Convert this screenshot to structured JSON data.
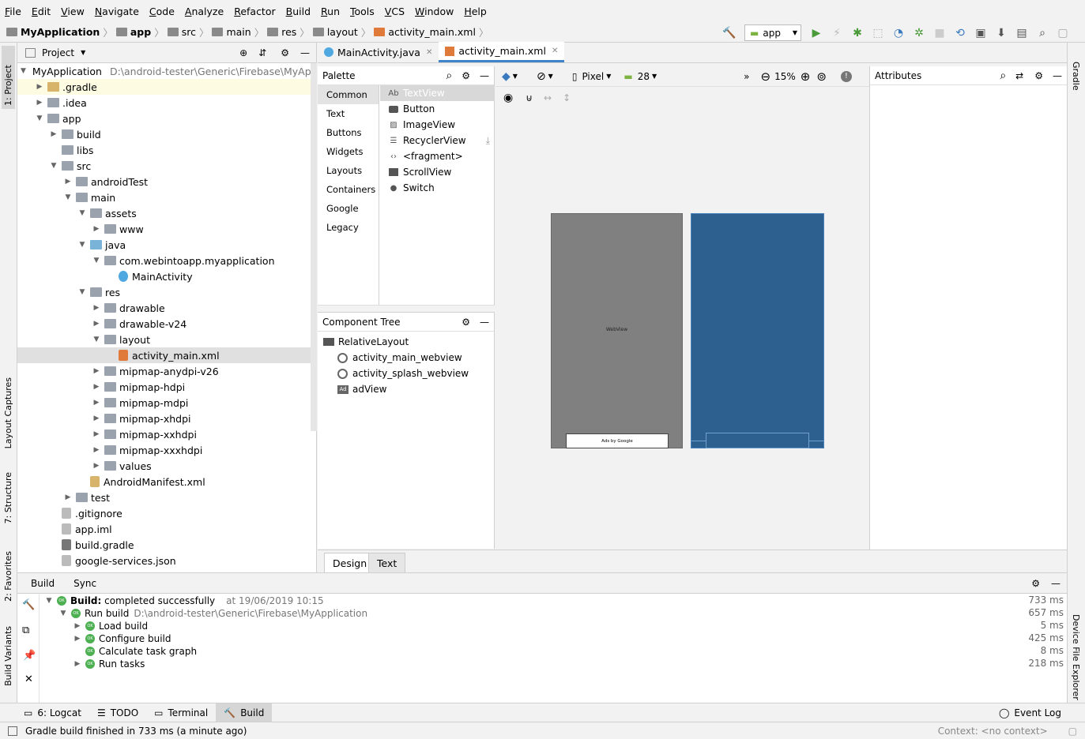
{
  "menu": [
    "File",
    "Edit",
    "View",
    "Navigate",
    "Code",
    "Analyze",
    "Refactor",
    "Build",
    "Run",
    "Tools",
    "VCS",
    "Window",
    "Help"
  ],
  "breadcrumb": [
    "MyApplication",
    "app",
    "src",
    "main",
    "res",
    "layout",
    "activity_main.xml"
  ],
  "run_config": "app",
  "left_tabs": {
    "project": "1: Project",
    "captures": "Layout Captures",
    "structure": "7: Structure",
    "favorites": "2: Favorites",
    "variants": "Build Variants"
  },
  "right_tabs": {
    "gradle": "Gradle",
    "device": "Device File Explorer"
  },
  "project_panel": {
    "title": "Project",
    "root": {
      "name": "MyApplication",
      "path": "D:\\android-tester\\Generic\\Firebase\\MyApplicati"
    },
    "items": [
      ".gradle",
      ".idea",
      "app",
      "build",
      "libs",
      "src",
      "androidTest",
      "main",
      "assets",
      "www",
      "java",
      "com.webintoapp.myapplication",
      "MainActivity",
      "res",
      "drawable",
      "drawable-v24",
      "layout",
      "activity_main.xml",
      "mipmap-anydpi-v26",
      "mipmap-hdpi",
      "mipmap-mdpi",
      "mipmap-xhdpi",
      "mipmap-xxhdpi",
      "mipmap-xxxhdpi",
      "values",
      "AndroidManifest.xml",
      "test",
      ".gitignore",
      "app.iml",
      "build.gradle",
      "google-services.json"
    ]
  },
  "editor_tabs": [
    "MainActivity.java",
    "activity_main.xml"
  ],
  "palette": {
    "title": "Palette",
    "categories": [
      "Common",
      "Text",
      "Buttons",
      "Widgets",
      "Layouts",
      "Containers",
      "Google",
      "Legacy"
    ],
    "items": [
      "TextView",
      "Button",
      "ImageView",
      "RecyclerView",
      "<fragment>",
      "ScrollView",
      "Switch"
    ],
    "textview_icon": "Ab"
  },
  "component_tree": {
    "title": "Component Tree",
    "items": [
      "RelativeLayout",
      "activity_main_webview",
      "activity_splash_webview",
      "adView"
    ],
    "ad_icon": "Ad"
  },
  "design_toolbar": {
    "device": "Pixel",
    "api": "28",
    "zoom": "15%"
  },
  "preview": {
    "webview_label": "WebView",
    "ads_label": "Ads by Google"
  },
  "attributes": {
    "title": "Attributes"
  },
  "bottom_tabs": [
    "Design",
    "Text"
  ],
  "build_panel": {
    "tabs": [
      "Build",
      "Sync"
    ],
    "root_label": "Build:",
    "root_status": "completed successfully",
    "root_time": "at 19/06/2019 10:15",
    "root_ms": "733 ms",
    "run_build": "Run build",
    "run_path": "D:\\android-tester\\Generic\\Firebase\\MyApplication",
    "run_ms": "657 ms",
    "tasks": [
      {
        "name": "Load build",
        "ms": "5 ms"
      },
      {
        "name": "Configure build",
        "ms": "425 ms"
      },
      {
        "name": "Calculate task graph",
        "ms": "8 ms"
      },
      {
        "name": "Run tasks",
        "ms": "218 ms"
      }
    ],
    "ok_badge": "OK"
  },
  "tool_tabs": {
    "logcat": "6: Logcat",
    "todo": "TODO",
    "terminal": "Terminal",
    "build": "Build",
    "event_log": "Event Log"
  },
  "status": {
    "message": "Gradle build finished in 733 ms (a minute ago)",
    "context": "Context: <no context>"
  },
  "colors": {
    "blueprint": "#2d5f8f",
    "webview_gray": "#808080",
    "selection": "#e0e0e0",
    "accent": "#4083c9"
  }
}
